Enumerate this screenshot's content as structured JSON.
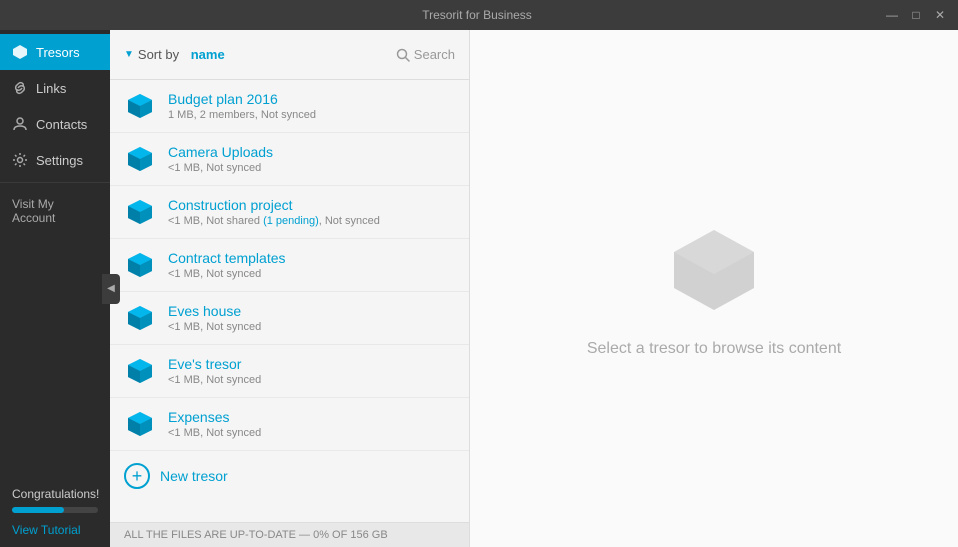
{
  "titleBar": {
    "title": "Tresorit for Business",
    "minimize": "—",
    "maximize": "□",
    "close": "✕"
  },
  "sidebar": {
    "collapseIcon": "◀",
    "items": [
      {
        "id": "tresors",
        "label": "Tresors",
        "icon": "tresor-icon",
        "active": true
      },
      {
        "id": "links",
        "label": "Links",
        "icon": "link-icon",
        "active": false
      },
      {
        "id": "contacts",
        "label": "Contacts",
        "icon": "contacts-icon",
        "active": false
      },
      {
        "id": "settings",
        "label": "Settings",
        "icon": "settings-icon",
        "active": false
      }
    ],
    "visitMyAccount": "Visit My Account",
    "congratulations": "Congratulations!",
    "progressValue": 60,
    "viewTutorial": "View Tutorial"
  },
  "tresorPanel": {
    "sortLabel": "Sort by",
    "sortField": "name",
    "searchPlaceholder": "Search",
    "tresors": [
      {
        "name": "Budget plan 2016",
        "meta": "1 MB, 2 members, Not synced",
        "hasPending": false
      },
      {
        "name": "Camera Uploads",
        "meta": "<1 MB, Not synced",
        "hasPending": false
      },
      {
        "name": "Construction project",
        "metaPrefix": "<1 MB, Not shared ",
        "pending": "(1 pending)",
        "metaSuffix": ", Not synced",
        "hasPending": true
      },
      {
        "name": "Contract templates",
        "meta": "<1 MB, Not synced",
        "hasPending": false
      },
      {
        "name": "Eves house",
        "meta": "<1 MB, Not synced",
        "hasPending": false
      },
      {
        "name": "Eve's tresor",
        "meta": "<1 MB, Not synced",
        "hasPending": false
      },
      {
        "name": "Expenses",
        "meta": "<1 MB, Not synced",
        "hasPending": false
      }
    ],
    "newTresor": "New tresor",
    "footer": "ALL THE FILES ARE UP-TO-DATE — 0% OF 156 GB"
  },
  "contentPanel": {
    "emptyText": "Select a tresor to browse its content"
  }
}
